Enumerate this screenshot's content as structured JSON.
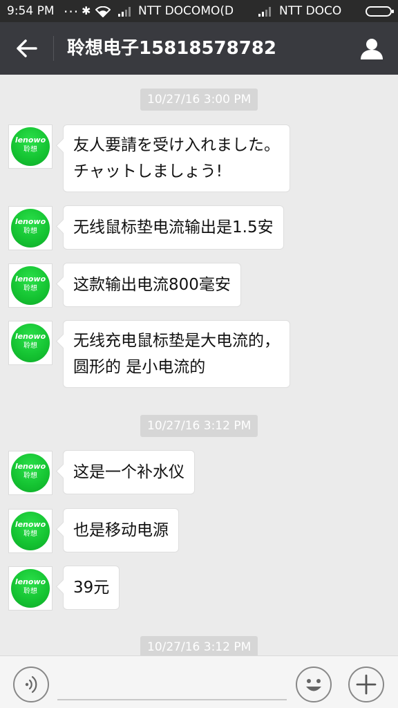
{
  "status_bar": {
    "time": "9:54 PM",
    "dots": "...",
    "carrier1": "NTT DOCOMO(D",
    "carrier2": "NTT DOCO"
  },
  "header": {
    "title": "聆想电子15818578782"
  },
  "avatar": {
    "brand": "lenowo",
    "brand_sub": "聆想"
  },
  "messages": [
    {
      "type": "timestamp",
      "text": "10/27/16 3:00 PM"
    },
    {
      "type": "incoming",
      "lines": [
        "友人要請を受け入れました。",
        "チャットしましょう!"
      ]
    },
    {
      "type": "incoming",
      "lines": [
        "无线鼠标垫电流输出是1.5安"
      ]
    },
    {
      "type": "incoming",
      "lines": [
        "这款输出电流800毫安"
      ]
    },
    {
      "type": "incoming",
      "lines": [
        "无线充电鼠标垫是大电流的，",
        "圆形的  是小电流的"
      ]
    },
    {
      "type": "timestamp",
      "text": "10/27/16 3:12 PM"
    },
    {
      "type": "incoming",
      "lines": [
        "这是一个补水仪"
      ]
    },
    {
      "type": "incoming",
      "lines": [
        "也是移动电源"
      ]
    },
    {
      "type": "incoming",
      "lines": [
        "39元"
      ]
    },
    {
      "type": "timestamp",
      "text": "10/27/16 3:12 PM"
    }
  ],
  "composer": {
    "value": "",
    "placeholder": ""
  },
  "colors": {
    "status_bar": "#2b2b2b",
    "app_bar": "#393a3f",
    "chat_bg": "#ebebeb",
    "bubble": "#ffffff",
    "timestamp_bg": "#d6d6d6",
    "avatar_green": "#14c231"
  },
  "icons": {
    "back": "arrow-left-icon",
    "profile": "person-icon",
    "voice": "voice-icon",
    "emoji": "smiley-icon",
    "plus": "plus-icon"
  }
}
